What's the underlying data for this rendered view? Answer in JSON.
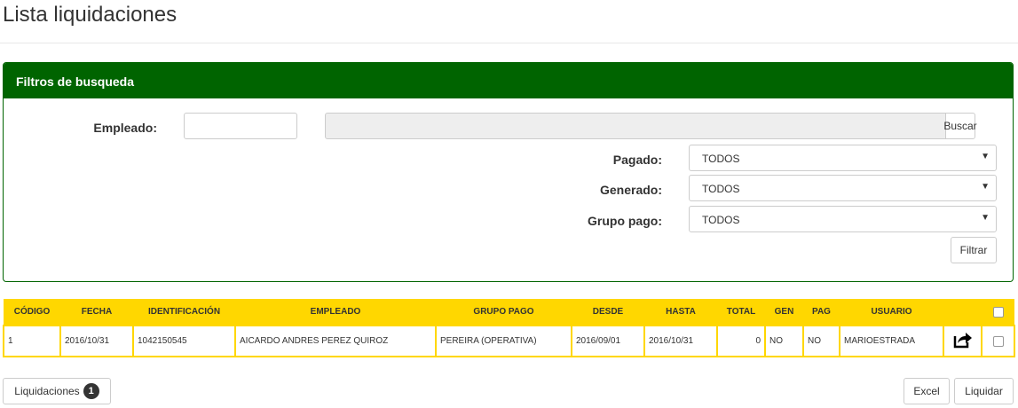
{
  "page": {
    "title": "Lista liquidaciones"
  },
  "filters": {
    "header": "Filtros de busqueda",
    "empleado_label": "Empleado:",
    "empleado_value": "",
    "empleado_name_value": "",
    "buscar_label": "Buscar",
    "pagado_label": "Pagado:",
    "pagado_value": "TODOS",
    "generado_label": "Generado:",
    "generado_value": "TODOS",
    "grupo_pago_label": "Grupo pago:",
    "grupo_pago_value": "TODOS",
    "filtrar_label": "Filtrar"
  },
  "table": {
    "headers": [
      "CÓDIGO",
      "FECHA",
      "IDENTIFICACIÓN",
      "EMPLEADO",
      "GRUPO PAGO",
      "DESDE",
      "HASTA",
      "TOTAL",
      "GEN",
      "PAG",
      "USUARIO"
    ],
    "rows": [
      [
        "1",
        "2016/10/31",
        "1042150545",
        "AICARDO ANDRES PEREZ QUIROZ",
        "PEREIRA (OPERATIVA)",
        "2016/09/01",
        "2016/10/31",
        "0",
        "NO",
        "NO",
        "MARIOESTRADA"
      ]
    ],
    "row_action_icon": "share-icon"
  },
  "footer": {
    "liquidaciones_label": "Liquidaciones",
    "liquidaciones_count": "1",
    "excel_label": "Excel",
    "liquidar_label": "Liquidar"
  },
  "colors": {
    "panel_green": "#006400",
    "table_yellow": "#ffd700"
  }
}
